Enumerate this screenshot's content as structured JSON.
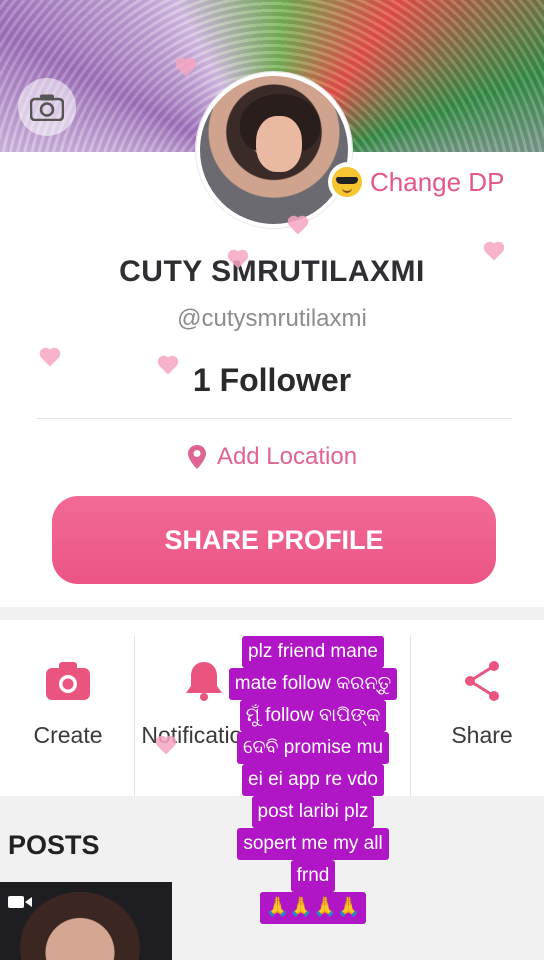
{
  "profile": {
    "change_dp_label": "Change DP",
    "name": "CUTY SMRUTILAXMI",
    "handle": "@cutysmrutilaxmi",
    "followers": "1 Follower",
    "location_label": "Add Location",
    "share_profile_label": "SHARE PROFILE"
  },
  "actions": [
    {
      "label": "Create",
      "icon": "camera-icon"
    },
    {
      "label": "Notifications",
      "icon": "bell-icon"
    },
    {
      "label": "",
      "icon": ""
    },
    {
      "label": "Share",
      "icon": "share-icon"
    }
  ],
  "posts": {
    "section_label": "POSTS"
  },
  "caption": {
    "lines": [
      "plz friend mane",
      "mate follow କରନ୍ତୁ",
      "ମୁଁ follow ବାପିଙ୍କ",
      "ଦେବି promise mu",
      "ei ei app re vdo",
      "post laribi plz",
      "sopert me my all",
      "frnd"
    ],
    "emoji": "🙏🙏🙏🙏"
  },
  "colors": {
    "accent": "#eb5585",
    "caption_bg": "#b016c6",
    "link": "#e06394"
  }
}
